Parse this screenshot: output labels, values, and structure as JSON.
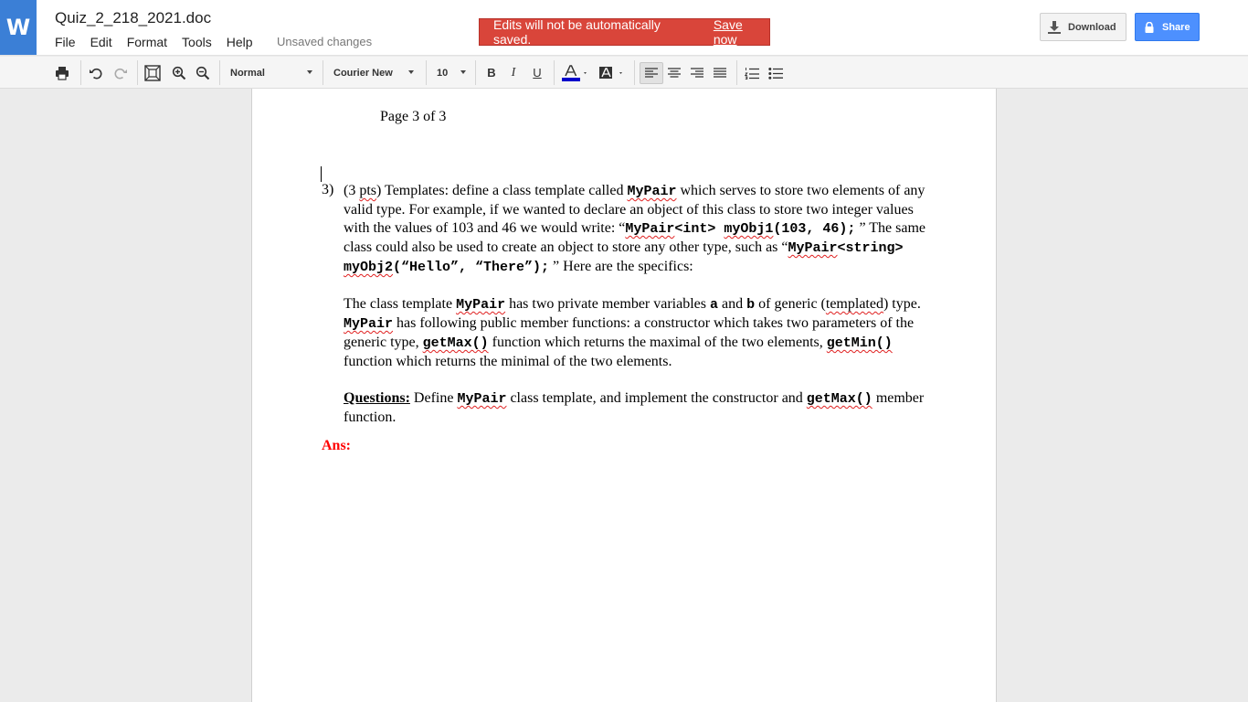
{
  "app": {
    "logo_letter": "W",
    "doc_title": "Quiz_2_218_2021.doc",
    "menu": [
      "File",
      "Edit",
      "Format",
      "Tools",
      "Help"
    ],
    "status": "Unsaved changes",
    "notice": {
      "text": "Edits will not be automatically saved.",
      "action": "Save now"
    },
    "download_label": "Download",
    "share_label": "Share"
  },
  "toolbar": {
    "style_value": "Normal",
    "font_value": "Courier New",
    "size_value": "10",
    "bold": "B",
    "italic": "I",
    "underline": "U",
    "text_color": "#0000cc"
  },
  "document": {
    "page_header": "Page 3 of 3",
    "question_number": "3)",
    "para1": {
      "t1": "(3 ",
      "pts": "pts",
      "t2": ") Templates: define a class template called ",
      "c1": "MyPair",
      "t3": " which serves to store two elements of any valid type. For example, if we wanted to declare an object of this class to store two integer values with the values of 103 and 46 we would write:  “",
      "c2a": "MyPair",
      "c2b": "<int> ",
      "c2c": "myObj1",
      "c2d": "(103, 46);",
      "t4": " ” The same class could also be used to create an object to store any other type, such as  “",
      "c3a": "MyPair",
      "c3b": "<string> ",
      "c3c": "myObj2",
      "c3d": "(“Hello”, “There”);",
      "t5": " ”  Here are the specifics:"
    },
    "para2": {
      "t1": "The class template ",
      "c1": "MyPair",
      "t2": " has two private member variables ",
      "a": "a",
      "t3": " and ",
      "b": "b",
      "t4": " of generic (",
      "templated": "templated",
      "t5": ") type. ",
      "c2": "MyPair",
      "t6": " has following public member functions: a constructor which takes two parameters of the generic type, ",
      "c3": "getMax()",
      "t7": " function which returns the maximal of the two elements, ",
      "c4": "getMin()",
      "t8": " function which returns the minimal of the two elements."
    },
    "para3": {
      "label": "Questions:",
      "t1": " Define ",
      "c1": "MyPair",
      "t2": " class template, and implement the constructor and ",
      "c2": "getMax()",
      "t3": " member function."
    },
    "ans_label": "Ans:"
  }
}
